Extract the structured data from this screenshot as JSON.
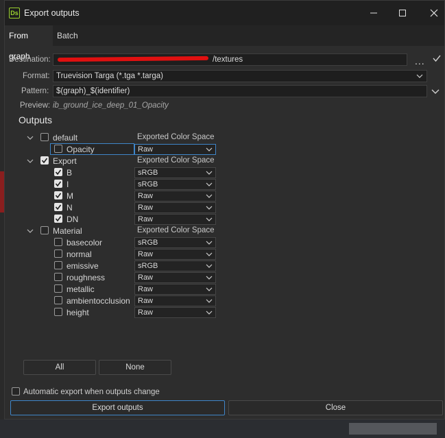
{
  "window": {
    "app_icon_text": "Ds",
    "title": "Export outputs",
    "controls": [
      "minimize-icon",
      "maximize-icon",
      "close-icon"
    ]
  },
  "tabs": [
    {
      "label": "From graph",
      "active": true
    },
    {
      "label": "Batch",
      "active": false
    }
  ],
  "form": {
    "destination_label": "Destination:",
    "destination_value_visible": "/textures",
    "destination_browse": "...",
    "format_label": "Format:",
    "format_value": "Truevision Targa (*.tga *.targa)",
    "pattern_label": "Pattern:",
    "pattern_value": "$(graph)_$(identifier)",
    "preview_label": "Preview:",
    "preview_value": "ib_ground_ice_deep_01_Opacity"
  },
  "outputs": {
    "title": "Outputs",
    "groups": [
      {
        "name": "default",
        "checked": false,
        "cs_header": "Exported Color Space",
        "items": [
          {
            "name": "Opacity",
            "checked": false,
            "color_space": "Raw"
          }
        ]
      },
      {
        "name": "Export",
        "checked": true,
        "cs_header": "Exported Color Space",
        "items": [
          {
            "name": "B",
            "checked": true,
            "color_space": "sRGB"
          },
          {
            "name": "I",
            "checked": true,
            "color_space": "sRGB"
          },
          {
            "name": "M",
            "checked": true,
            "color_space": "Raw"
          },
          {
            "name": "N",
            "checked": true,
            "color_space": "Raw"
          },
          {
            "name": "DN",
            "checked": true,
            "color_space": "Raw"
          }
        ]
      },
      {
        "name": "Material",
        "checked": false,
        "cs_header": "Exported Color Space",
        "items": [
          {
            "name": "basecolor",
            "checked": false,
            "color_space": "sRGB"
          },
          {
            "name": "normal",
            "checked": false,
            "color_space": "Raw"
          },
          {
            "name": "emissive",
            "checked": false,
            "color_space": "sRGB"
          },
          {
            "name": "roughness",
            "checked": false,
            "color_space": "Raw"
          },
          {
            "name": "metallic",
            "checked": false,
            "color_space": "Raw"
          },
          {
            "name": "ambientocclusion",
            "checked": false,
            "color_space": "Raw"
          },
          {
            "name": "height",
            "checked": false,
            "color_space": "Raw"
          }
        ]
      }
    ]
  },
  "buttons": {
    "all": "All",
    "none": "None",
    "export": "Export outputs",
    "close": "Close"
  },
  "auto_export": {
    "label": "Automatic export when outputs change",
    "checked": false
  },
  "colors": {
    "accent": "#3f86c9",
    "redaction": "#e01010",
    "app_icon": "#9bd22f"
  }
}
